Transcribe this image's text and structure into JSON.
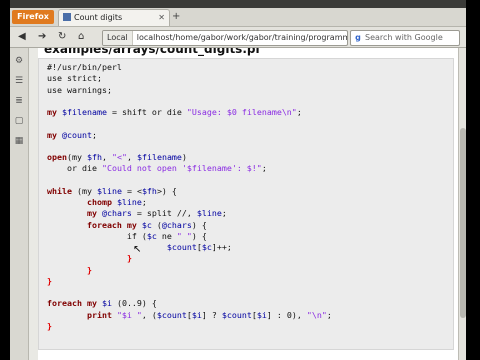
{
  "browser": {
    "app_button": "Firefox",
    "tab_title": "Count digits",
    "identity_label": "Local",
    "url": "localhost/home/gabor/work/gabor/training/programming_perl/",
    "search_placeholder": "Search with Google"
  },
  "page": {
    "heading": "examples/arrays/count_digits.pl"
  },
  "code_lines": [
    [
      {
        "t": "#!/usr/bin/perl"
      }
    ],
    [
      {
        "t": "use strict;"
      }
    ],
    [
      {
        "t": "use warnings;"
      }
    ],
    [
      {
        "t": ""
      }
    ],
    [
      {
        "t": "my ",
        "c": "kw"
      },
      {
        "t": "$filename",
        "c": "var"
      },
      {
        "t": " = shift or die "
      },
      {
        "t": "\"Usage: $0 filename\\n\"",
        "c": "str"
      },
      {
        "t": ";"
      }
    ],
    [
      {
        "t": ""
      }
    ],
    [
      {
        "t": "my ",
        "c": "kw"
      },
      {
        "t": "@count",
        "c": "var"
      },
      {
        "t": ";"
      }
    ],
    [
      {
        "t": ""
      }
    ],
    [
      {
        "t": "open",
        "c": "kw"
      },
      {
        "t": "(my "
      },
      {
        "t": "$fh",
        "c": "var"
      },
      {
        "t": ", "
      },
      {
        "t": "\"<\"",
        "c": "str"
      },
      {
        "t": ", "
      },
      {
        "t": "$filename",
        "c": "var"
      },
      {
        "t": ")"
      }
    ],
    [
      {
        "t": "    or die "
      },
      {
        "t": "\"Could not open '$filename': $!\"",
        "c": "str"
      },
      {
        "t": ";"
      }
    ],
    [
      {
        "t": ""
      }
    ],
    [
      {
        "t": "while",
        "c": "kw"
      },
      {
        "t": " (my "
      },
      {
        "t": "$line",
        "c": "var"
      },
      {
        "t": " = <"
      },
      {
        "t": "$fh",
        "c": "var"
      },
      {
        "t": ">) {"
      }
    ],
    [
      {
        "t": "        chomp ",
        "c": "kw"
      },
      {
        "t": "$line",
        "c": "var"
      },
      {
        "t": ";"
      }
    ],
    [
      {
        "t": "        my ",
        "c": "kw"
      },
      {
        "t": "@chars",
        "c": "var"
      },
      {
        "t": " = split //, "
      },
      {
        "t": "$line",
        "c": "var"
      },
      {
        "t": ";"
      }
    ],
    [
      {
        "t": "        foreach my ",
        "c": "kw"
      },
      {
        "t": "$c",
        "c": "var"
      },
      {
        "t": " ("
      },
      {
        "t": "@chars",
        "c": "var"
      },
      {
        "t": ") {"
      }
    ],
    [
      {
        "t": "                if ("
      },
      {
        "t": "$c",
        "c": "var"
      },
      {
        "t": " ne "
      },
      {
        "t": "\" \"",
        "c": "str"
      },
      {
        "t": ") {"
      }
    ],
    [
      {
        "t": "                        "
      },
      {
        "t": "$count",
        "c": "var"
      },
      {
        "t": "["
      },
      {
        "t": "$c",
        "c": "var"
      },
      {
        "t": "]++;"
      }
    ],
    [
      {
        "t": "                "
      },
      {
        "t": "}",
        "c": "br"
      }
    ],
    [
      {
        "t": "        "
      },
      {
        "t": "}",
        "c": "br"
      }
    ],
    [
      {
        "t": "}",
        "c": "br"
      }
    ],
    [
      {
        "t": ""
      }
    ],
    [
      {
        "t": "foreach my ",
        "c": "kw"
      },
      {
        "t": "$i",
        "c": "var"
      },
      {
        "t": " (0..9) {"
      }
    ],
    [
      {
        "t": "        print ",
        "c": "kw"
      },
      {
        "t": "\"$i \"",
        "c": "str"
      },
      {
        "t": ", ("
      },
      {
        "t": "$count",
        "c": "var"
      },
      {
        "t": "["
      },
      {
        "t": "$i",
        "c": "var"
      },
      {
        "t": "] ? "
      },
      {
        "t": "$count",
        "c": "var"
      },
      {
        "t": "["
      },
      {
        "t": "$i",
        "c": "var"
      },
      {
        "t": "] : 0), "
      },
      {
        "t": "\"\\n\"",
        "c": "str"
      },
      {
        "t": ";"
      }
    ],
    [
      {
        "t": "}",
        "c": "br"
      }
    ]
  ]
}
